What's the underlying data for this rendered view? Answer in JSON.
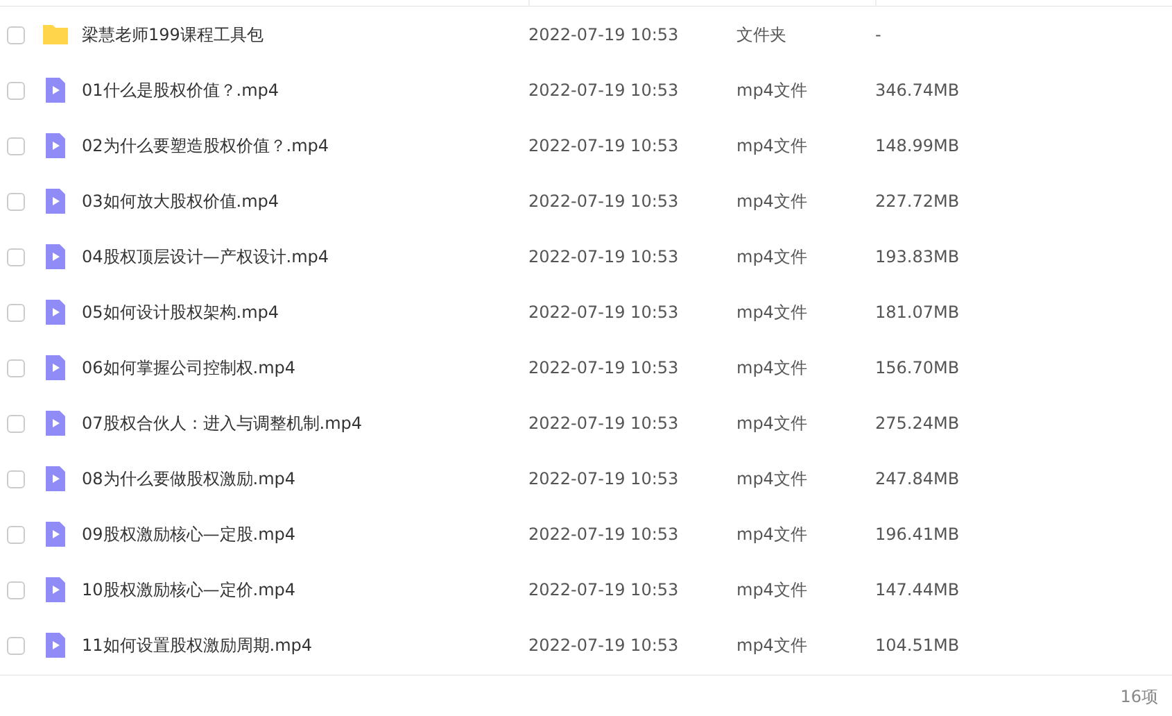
{
  "files": [
    {
      "kind": "folder",
      "checked": false,
      "name": "梁慧老师199课程工具包",
      "modified": "2022-07-19 10:53",
      "type": "文件夹",
      "size": "-"
    },
    {
      "kind": "video",
      "checked": false,
      "name": "01什么是股权价值？.mp4",
      "modified": "2022-07-19 10:53",
      "type": "mp4文件",
      "size": "346.74MB"
    },
    {
      "kind": "video",
      "checked": false,
      "name": "02为什么要塑造股权价值？.mp4",
      "modified": "2022-07-19 10:53",
      "type": "mp4文件",
      "size": "148.99MB"
    },
    {
      "kind": "video",
      "checked": false,
      "name": "03如何放大股权价值.mp4",
      "modified": "2022-07-19 10:53",
      "type": "mp4文件",
      "size": "227.72MB"
    },
    {
      "kind": "video",
      "checked": false,
      "name": "04股权顶层设计—产权设计.mp4",
      "modified": "2022-07-19 10:53",
      "type": "mp4文件",
      "size": "193.83MB"
    },
    {
      "kind": "video",
      "checked": false,
      "name": "05如何设计股权架构.mp4",
      "modified": "2022-07-19 10:53",
      "type": "mp4文件",
      "size": "181.07MB"
    },
    {
      "kind": "video",
      "checked": false,
      "name": "06如何掌握公司控制权.mp4",
      "modified": "2022-07-19 10:53",
      "type": "mp4文件",
      "size": "156.70MB"
    },
    {
      "kind": "video",
      "checked": false,
      "name": "07股权合伙人：进入与调整机制.mp4",
      "modified": "2022-07-19 10:53",
      "type": "mp4文件",
      "size": "275.24MB"
    },
    {
      "kind": "video",
      "checked": false,
      "name": "08为什么要做股权激励.mp4",
      "modified": "2022-07-19 10:53",
      "type": "mp4文件",
      "size": "247.84MB"
    },
    {
      "kind": "video",
      "checked": false,
      "name": "09股权激励核心—定股.mp4",
      "modified": "2022-07-19 10:53",
      "type": "mp4文件",
      "size": "196.41MB"
    },
    {
      "kind": "video",
      "checked": false,
      "name": "10股权激励核心—定价.mp4",
      "modified": "2022-07-19 10:53",
      "type": "mp4文件",
      "size": "147.44MB"
    },
    {
      "kind": "video",
      "checked": false,
      "name": "11如何设置股权激励周期.mp4",
      "modified": "2022-07-19 10:53",
      "type": "mp4文件",
      "size": "104.51MB"
    }
  ],
  "item_count": "16项"
}
